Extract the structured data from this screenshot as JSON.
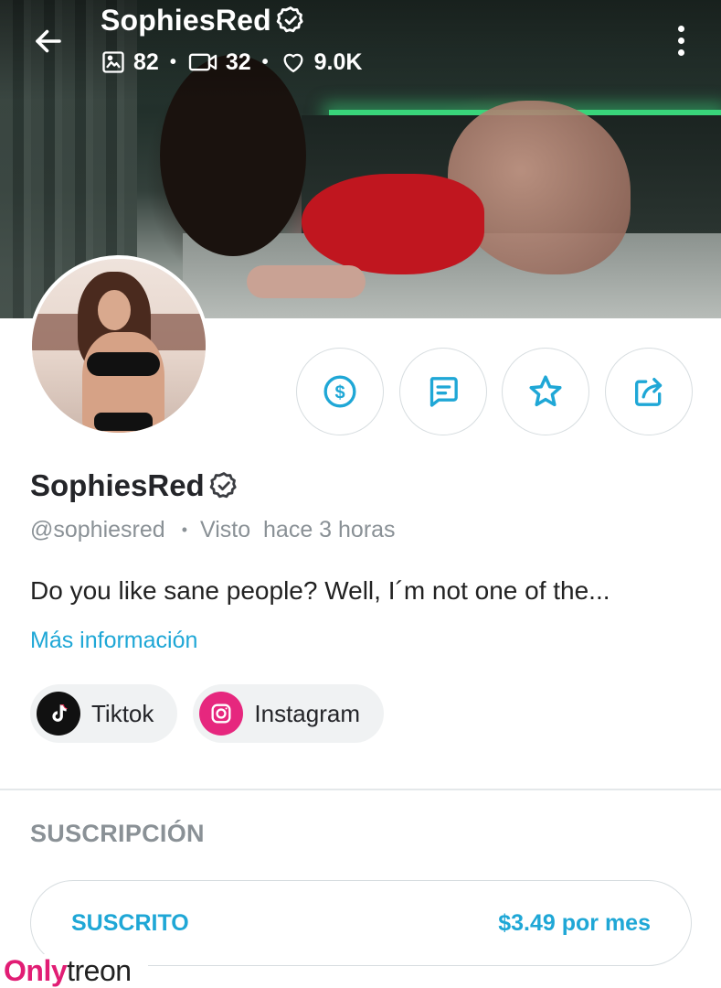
{
  "header": {
    "title": "SophiesRed",
    "stats": {
      "images": "82",
      "videos": "32",
      "likes": "9.0K"
    }
  },
  "profile": {
    "name": "SophiesRed",
    "handle": "@sophiesred",
    "last_seen": "Visto  hace 3 horas",
    "bio": "Do you like sane people? Well, I´m not one of the...",
    "more_info_label": "Más información"
  },
  "socials": [
    {
      "label": "Tiktok",
      "icon": "tiktok-icon",
      "color": "#111111"
    },
    {
      "label": "Instagram",
      "icon": "instagram-icon",
      "color": "#e6277e"
    }
  ],
  "actions": [
    {
      "icon": "dollar-icon"
    },
    {
      "icon": "message-icon"
    },
    {
      "icon": "star-icon"
    },
    {
      "icon": "share-icon"
    }
  ],
  "subscription": {
    "section_title": "SUSCRIPCIÓN",
    "state_label": "SUSCRITO",
    "price_label": "$3.49 por mes"
  },
  "watermark": {
    "brand_a": "Only",
    "brand_b": "treon"
  },
  "colors": {
    "accent": "#1fa7d6",
    "muted": "#8a9196",
    "brand_pink": "#e11d74"
  }
}
